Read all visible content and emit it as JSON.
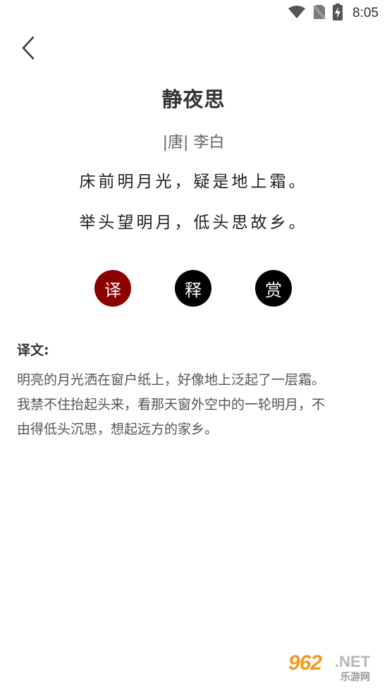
{
  "status_bar": {
    "time": "8:05",
    "icons": [
      "wifi-icon",
      "no-sim-icon",
      "battery-charging-icon"
    ]
  },
  "nav": {
    "back_icon": "chevron-left-icon"
  },
  "poem": {
    "title": "静夜思",
    "meta": "|唐| 李白",
    "lines": [
      "床前明月光，疑是地上霜。",
      "举头望明月，低头思故乡。"
    ]
  },
  "actions": {
    "translate_label": "译",
    "annotate_label": "释",
    "appreciate_label": "赏",
    "active_color": "#8b0000",
    "inactive_color": "#000000"
  },
  "translation": {
    "heading": "译文:",
    "lines": [
      "明亮的月光洒在窗户纸上，好像地上泛起了一层霜。",
      "我禁不住抬起头来，看那天窗外空中的一轮明月，不",
      "由得低头沉思，想起远方的家乡。"
    ]
  },
  "watermark": {
    "number": "962",
    "domain": ".NET",
    "cn": "乐游网"
  }
}
